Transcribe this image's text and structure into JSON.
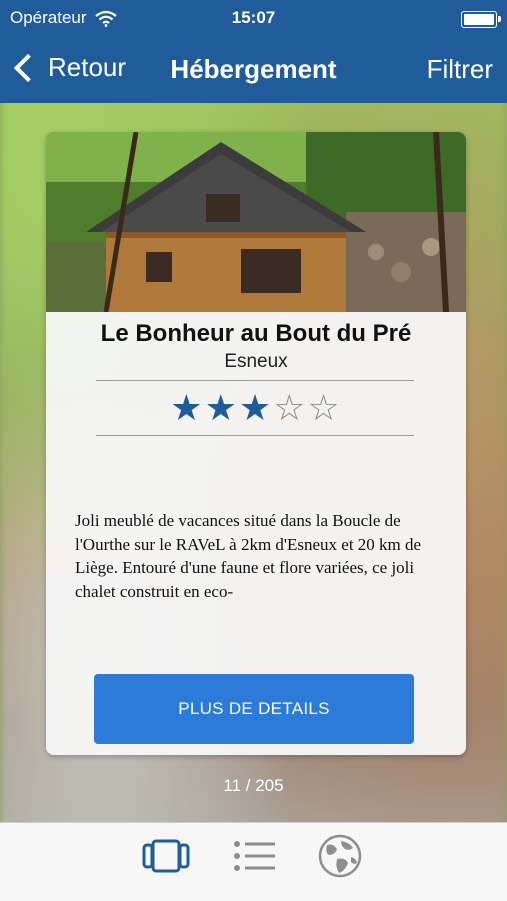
{
  "status": {
    "carrier": "Opérateur",
    "time": "15:07"
  },
  "nav": {
    "back_label": "Retour",
    "title": "Hébergement",
    "filter_label": "Filtrer"
  },
  "card": {
    "name": "Le Bonheur au Bout du Pré",
    "city": "Esneux",
    "rating": 3,
    "rating_max": 5,
    "description": "Joli meublé de vacances situé dans la Boucle de l'Ourthe sur le RAVeL à 2km d'Esneux et 20 km de Liège. Entouré d'une faune et flore variées, ce joli chalet construit en eco-",
    "details_button": "PLUS DE DETAILS"
  },
  "pager": "11 / 205",
  "tabs": [
    {
      "name": "cards-view",
      "icon": "carousel-icon",
      "active": true
    },
    {
      "name": "list-view",
      "icon": "list-icon",
      "active": false
    },
    {
      "name": "map-view",
      "icon": "globe-icon",
      "active": false
    }
  ],
  "colors": {
    "nav_bg": "#1f5c99",
    "accent": "#2c7bd9",
    "star": "#1f5c99",
    "inactive_icon": "#8e8e8e"
  }
}
